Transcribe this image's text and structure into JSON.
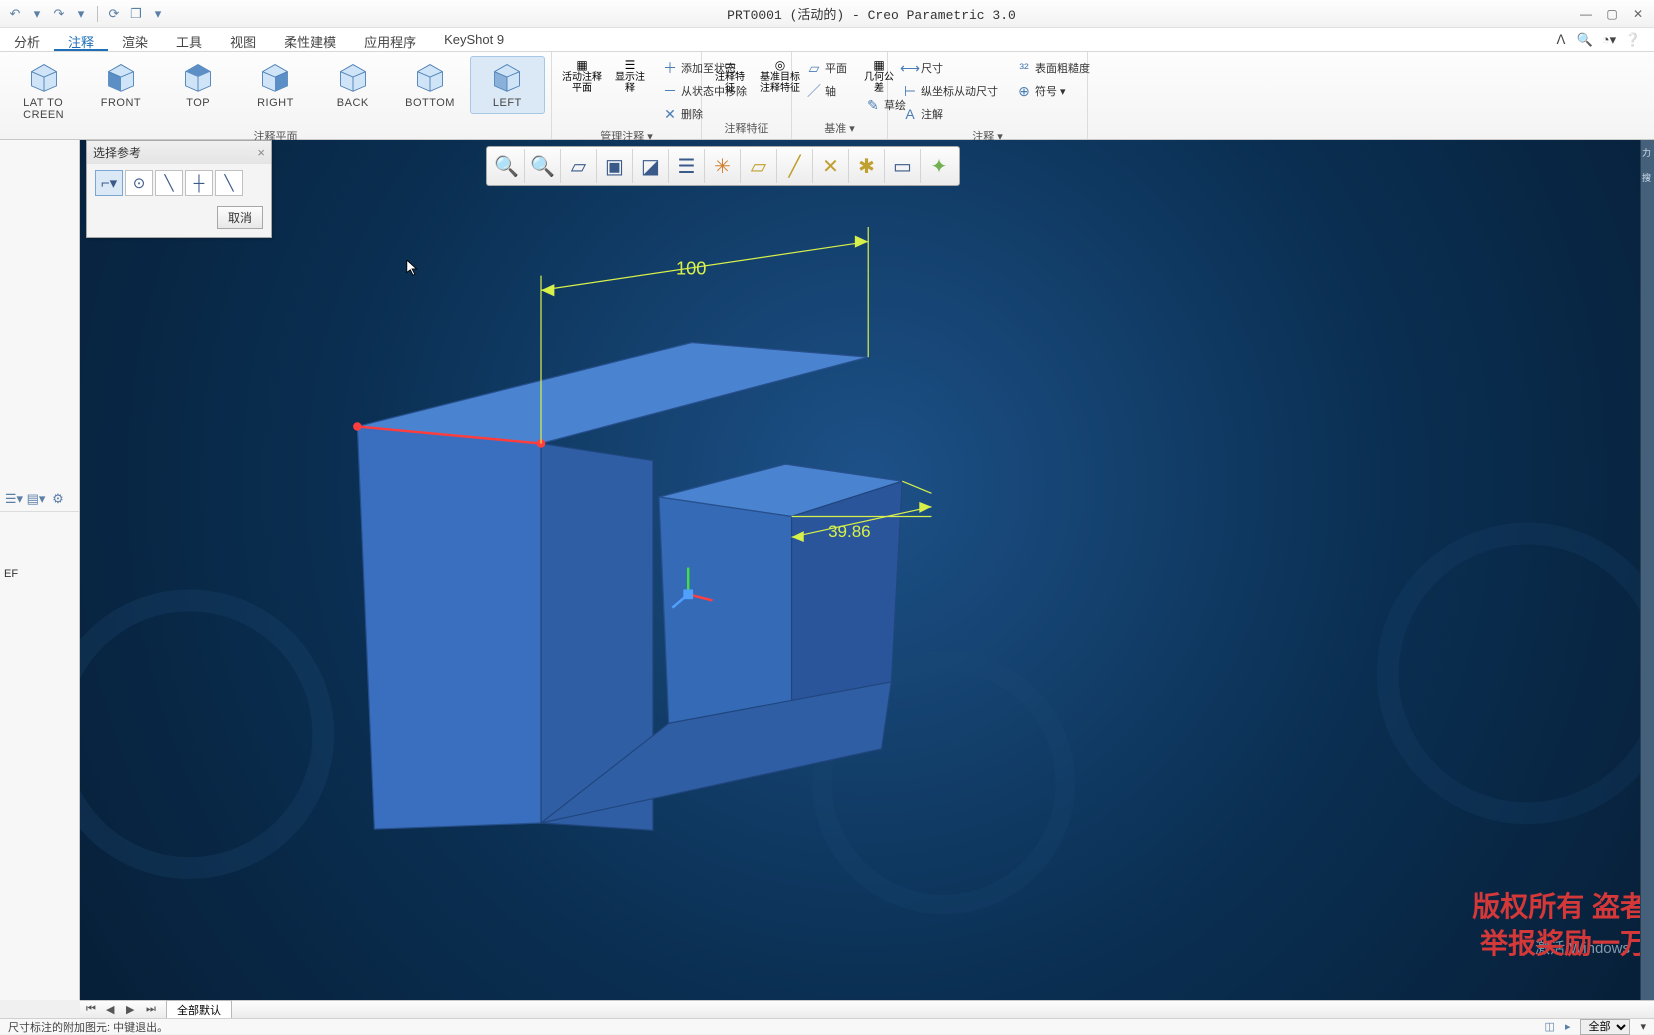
{
  "title": "PRT0001 (活动的) - Creo Parametric 3.0",
  "tabs": {
    "analysis": "分析",
    "annotate": "注释",
    "render": "渲染",
    "tools": "工具",
    "view": "视图",
    "flex": "柔性建模",
    "app": "应用程序",
    "keyshot": "KeyShot 9"
  },
  "ribbon": {
    "views": {
      "flat": "LAT TO\nCREEN",
      "front": "FRONT",
      "top": "TOP",
      "right": "RIGHT",
      "back": "BACK",
      "bottom": "BOTTOM",
      "left": "LEFT"
    },
    "group_plane": "注释平面",
    "group_manage": "管理注释 ▾",
    "group_feature": "注释特征",
    "group_datum": "基准 ▾",
    "group_annot": "注释 ▾",
    "active_plane_hdr": "活动注释平面",
    "show_annot": "显示注释",
    "add_state": "添加至状态",
    "remove_state": "从状态中移除",
    "delete": "删除",
    "annot_feature": "注释特征",
    "datum_target": "基准目标注释特征",
    "plane_lbl": "平面",
    "axis_lbl": "轴",
    "geom_tol": "几何公差",
    "sketch": "草绘",
    "dim_lbl": "尺寸",
    "ord_dim": "纵坐标从动尺寸",
    "note_lbl": "注解",
    "surf_rough": "表面粗糙度",
    "symbol": "符号 ▾"
  },
  "refbox": {
    "title": "选择参考",
    "cancel": "取消"
  },
  "model": {
    "dim1": "100",
    "dim2": "39.86"
  },
  "left_letters": "EF",
  "bottom": {
    "saved_default": "全部默认"
  },
  "status": {
    "hint": "尺寸标注的附加图元: 中键退出。",
    "all": "全部"
  },
  "wm": {
    "line1": "版权所有 盗者",
    "line2": "举报奖励一万",
    "win": "激活 Windows"
  },
  "right_sliver": {
    "t1": "力",
    "t2": "搜"
  }
}
